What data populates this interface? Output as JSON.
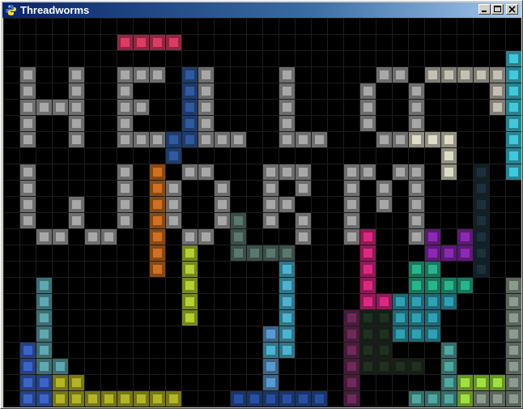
{
  "window": {
    "title": "Threadworms",
    "icon": "python-snake-icon",
    "buttons": [
      {
        "name": "minimize-button",
        "icon": "minimize-icon"
      },
      {
        "name": "maximize-button",
        "icon": "maximize-icon"
      },
      {
        "name": "close-button",
        "icon": "close-icon"
      }
    ]
  },
  "board": {
    "cols": 32,
    "rows": 24,
    "background": "#000000",
    "grid_color": "#1c1c1c",
    "worms": [
      {
        "color": "#dc3c64",
        "cells": [
          [
            7,
            1
          ],
          [
            8,
            1
          ],
          [
            9,
            1
          ],
          [
            10,
            1
          ]
        ]
      },
      {
        "color": "#a8a8a8",
        "cells": [
          [
            1,
            3
          ],
          [
            1,
            4
          ],
          [
            1,
            5
          ],
          [
            1,
            6
          ],
          [
            1,
            7
          ],
          [
            2,
            5
          ],
          [
            3,
            5
          ],
          [
            4,
            3
          ],
          [
            4,
            4
          ],
          [
            4,
            5
          ],
          [
            4,
            6
          ],
          [
            4,
            7
          ]
        ]
      },
      {
        "color": "#a8a8a8",
        "cells": [
          [
            7,
            3
          ],
          [
            8,
            3
          ],
          [
            9,
            3
          ],
          [
            7,
            4
          ],
          [
            7,
            5
          ],
          [
            8,
            5
          ],
          [
            7,
            6
          ],
          [
            7,
            7
          ],
          [
            8,
            7
          ],
          [
            9,
            7
          ]
        ]
      },
      {
        "color": "#2f5aa0",
        "cells": [
          [
            11,
            3
          ],
          [
            11,
            4
          ],
          [
            11,
            5
          ],
          [
            11,
            6
          ],
          [
            11,
            7
          ],
          [
            10,
            7
          ],
          [
            10,
            8
          ]
        ]
      },
      {
        "color": "#a8a8a8",
        "cells": [
          [
            12,
            3
          ],
          [
            12,
            4
          ],
          [
            12,
            5
          ],
          [
            12,
            6
          ],
          [
            12,
            7
          ],
          [
            13,
            7
          ],
          [
            14,
            7
          ]
        ]
      },
      {
        "color": "#a8a8a8",
        "cells": [
          [
            17,
            3
          ],
          [
            17,
            4
          ],
          [
            17,
            5
          ],
          [
            17,
            6
          ],
          [
            17,
            7
          ],
          [
            18,
            7
          ],
          [
            19,
            7
          ]
        ]
      },
      {
        "color": "#a8a8a8",
        "cells": [
          [
            23,
            3
          ],
          [
            24,
            3
          ],
          [
            22,
            4
          ],
          [
            25,
            4
          ],
          [
            22,
            5
          ],
          [
            25,
            5
          ],
          [
            22,
            6
          ],
          [
            25,
            6
          ],
          [
            23,
            7
          ],
          [
            24,
            7
          ]
        ]
      },
      {
        "color": "#c4c0b4",
        "cells": [
          [
            26,
            3
          ],
          [
            27,
            3
          ],
          [
            28,
            3
          ],
          [
            29,
            3
          ],
          [
            30,
            3
          ],
          [
            30,
            4
          ],
          [
            30,
            5
          ]
        ]
      },
      {
        "color": "#e0dcc8",
        "cells": [
          [
            25,
            7
          ],
          [
            26,
            7
          ],
          [
            27,
            7
          ],
          [
            27,
            8
          ],
          [
            27,
            9
          ]
        ]
      },
      {
        "color": "#40c8dc",
        "cells": [
          [
            31,
            2
          ],
          [
            31,
            3
          ],
          [
            31,
            4
          ],
          [
            31,
            5
          ],
          [
            31,
            6
          ],
          [
            31,
            7
          ],
          [
            31,
            8
          ],
          [
            31,
            9
          ]
        ]
      },
      {
        "color": "#a8a8a8",
        "cells": [
          [
            1,
            9
          ],
          [
            1,
            10
          ],
          [
            1,
            11
          ],
          [
            1,
            12
          ],
          [
            2,
            13
          ],
          [
            3,
            13
          ],
          [
            4,
            11
          ],
          [
            4,
            12
          ],
          [
            5,
            13
          ],
          [
            6,
            13
          ],
          [
            7,
            9
          ],
          [
            7,
            10
          ],
          [
            7,
            11
          ],
          [
            7,
            12
          ]
        ]
      },
      {
        "color": "#d07020",
        "cells": [
          [
            9,
            9
          ],
          [
            9,
            10
          ],
          [
            9,
            11
          ],
          [
            9,
            12
          ],
          [
            9,
            13
          ],
          [
            9,
            14
          ],
          [
            9,
            15
          ]
        ]
      },
      {
        "color": "#a8a8a8",
        "cells": [
          [
            10,
            10
          ],
          [
            10,
            11
          ],
          [
            10,
            12
          ],
          [
            11,
            9
          ],
          [
            12,
            9
          ],
          [
            13,
            10
          ],
          [
            13,
            11
          ],
          [
            13,
            12
          ],
          [
            11,
            13
          ],
          [
            12,
            13
          ]
        ]
      },
      {
        "color": "#a8a8a8",
        "cells": [
          [
            16,
            9
          ],
          [
            17,
            9
          ],
          [
            18,
            9
          ],
          [
            16,
            10
          ],
          [
            18,
            10
          ],
          [
            16,
            11
          ],
          [
            17,
            11
          ],
          [
            16,
            12
          ],
          [
            18,
            12
          ],
          [
            18,
            13
          ]
        ]
      },
      {
        "color": "#5a7870",
        "cells": [
          [
            14,
            12
          ],
          [
            14,
            13
          ],
          [
            14,
            14
          ],
          [
            15,
            14
          ],
          [
            16,
            14
          ],
          [
            17,
            14
          ]
        ]
      },
      {
        "color": "#a8a8a8",
        "cells": [
          [
            21,
            9
          ],
          [
            22,
            9
          ],
          [
            21,
            10
          ],
          [
            21,
            11
          ],
          [
            21,
            12
          ],
          [
            21,
            13
          ],
          [
            23,
            10
          ],
          [
            23,
            11
          ],
          [
            24,
            9
          ],
          [
            25,
            9
          ],
          [
            25,
            10
          ],
          [
            25,
            11
          ],
          [
            25,
            12
          ],
          [
            25,
            13
          ]
        ]
      },
      {
        "color": "#1c303c",
        "cells": [
          [
            29,
            9
          ],
          [
            29,
            10
          ],
          [
            29,
            11
          ],
          [
            29,
            12
          ],
          [
            29,
            13
          ],
          [
            29,
            14
          ],
          [
            29,
            15
          ]
        ]
      },
      {
        "color": "#b4d032",
        "cells": [
          [
            11,
            14
          ],
          [
            11,
            15
          ],
          [
            11,
            16
          ],
          [
            11,
            17
          ],
          [
            11,
            18
          ]
        ]
      },
      {
        "color": "#dc2882",
        "cells": [
          [
            22,
            13
          ],
          [
            22,
            14
          ],
          [
            22,
            15
          ],
          [
            22,
            16
          ],
          [
            22,
            17
          ],
          [
            23,
            17
          ]
        ]
      },
      {
        "color": "#8c28b4",
        "cells": [
          [
            26,
            13
          ],
          [
            26,
            14
          ],
          [
            27,
            14
          ],
          [
            28,
            14
          ],
          [
            28,
            13
          ]
        ]
      },
      {
        "color": "#28b48c",
        "cells": [
          [
            25,
            15
          ],
          [
            26,
            15
          ],
          [
            25,
            16
          ],
          [
            26,
            16
          ],
          [
            27,
            16
          ],
          [
            28,
            16
          ]
        ]
      },
      {
        "color": "#4cb4d0",
        "cells": [
          [
            17,
            15
          ],
          [
            17,
            16
          ],
          [
            17,
            17
          ],
          [
            17,
            18
          ],
          [
            17,
            19
          ],
          [
            17,
            20
          ],
          [
            16,
            20
          ]
        ]
      },
      {
        "color": "#5a9ad0",
        "cells": [
          [
            16,
            19
          ],
          [
            16,
            21
          ],
          [
            16,
            22
          ]
        ]
      },
      {
        "color": "#30a0b4",
        "cells": [
          [
            24,
            17
          ],
          [
            25,
            17
          ],
          [
            26,
            17
          ],
          [
            27,
            17
          ],
          [
            24,
            18
          ],
          [
            25,
            18
          ],
          [
            26,
            18
          ],
          [
            24,
            19
          ],
          [
            25,
            19
          ],
          [
            26,
            19
          ]
        ]
      },
      {
        "color": "#60a8b0",
        "cells": [
          [
            2,
            16
          ],
          [
            2,
            17
          ],
          [
            2,
            18
          ],
          [
            2,
            19
          ],
          [
            2,
            20
          ],
          [
            2,
            21
          ],
          [
            3,
            21
          ]
        ]
      },
      {
        "color": "#3c64c8",
        "cells": [
          [
            1,
            20
          ],
          [
            1,
            21
          ],
          [
            1,
            22
          ],
          [
            1,
            23
          ],
          [
            2,
            22
          ],
          [
            2,
            23
          ]
        ]
      },
      {
        "color": "#b4b428",
        "cells": [
          [
            3,
            22
          ],
          [
            4,
            22
          ],
          [
            3,
            23
          ],
          [
            4,
            23
          ],
          [
            5,
            23
          ],
          [
            6,
            23
          ],
          [
            7,
            23
          ],
          [
            8,
            23
          ],
          [
            9,
            23
          ],
          [
            10,
            23
          ]
        ]
      },
      {
        "color": "#2850a0",
        "cells": [
          [
            14,
            23
          ],
          [
            15,
            23
          ],
          [
            16,
            23
          ],
          [
            17,
            23
          ],
          [
            18,
            23
          ],
          [
            19,
            23
          ]
        ]
      },
      {
        "color": "#6e2a5a",
        "cells": [
          [
            21,
            18
          ],
          [
            21,
            19
          ],
          [
            21,
            20
          ],
          [
            21,
            21
          ],
          [
            21,
            22
          ],
          [
            21,
            23
          ]
        ]
      },
      {
        "color": "#203020",
        "cells": [
          [
            22,
            18
          ],
          [
            23,
            18
          ],
          [
            22,
            19
          ],
          [
            23,
            19
          ],
          [
            22,
            20
          ],
          [
            23,
            20
          ],
          [
            22,
            21
          ],
          [
            23,
            21
          ],
          [
            24,
            21
          ],
          [
            25,
            21
          ]
        ]
      },
      {
        "color": "#50a8a0",
        "cells": [
          [
            27,
            20
          ],
          [
            27,
            21
          ],
          [
            27,
            22
          ],
          [
            27,
            23
          ],
          [
            26,
            23
          ],
          [
            25,
            23
          ]
        ]
      },
      {
        "color": "#a0e040",
        "cells": [
          [
            28,
            22
          ],
          [
            29,
            22
          ],
          [
            30,
            22
          ],
          [
            28,
            23
          ]
        ]
      },
      {
        "color": "#8c9c8c",
        "cells": [
          [
            31,
            16
          ],
          [
            31,
            17
          ],
          [
            31,
            18
          ],
          [
            31,
            19
          ],
          [
            31,
            20
          ],
          [
            31,
            21
          ],
          [
            31,
            22
          ],
          [
            31,
            23
          ],
          [
            30,
            23
          ],
          [
            29,
            23
          ]
        ]
      }
    ]
  }
}
